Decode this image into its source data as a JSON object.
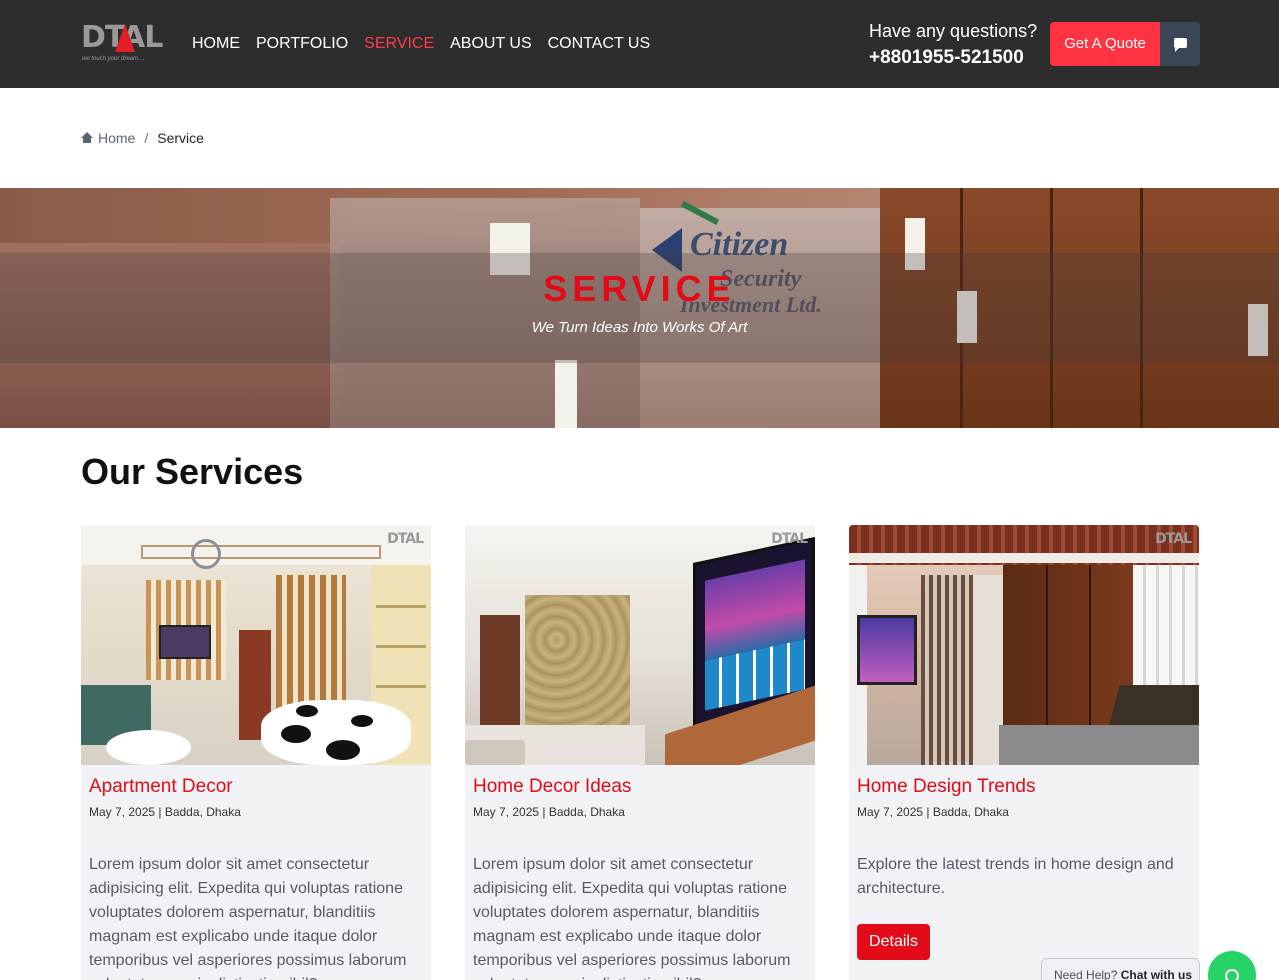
{
  "header": {
    "logo_text": "DTAL",
    "logo_tagline": "we touch your dream....",
    "nav": [
      {
        "label": "HOME"
      },
      {
        "label": "PORTFOLIO"
      },
      {
        "label": "SERVICE"
      },
      {
        "label": "ABOUT US"
      },
      {
        "label": "CONTACT US"
      }
    ],
    "active_nav": "SERVICE",
    "questions_label": "Have any questions?",
    "phone": "+8801955-521500",
    "quote_button": "Get A Quote",
    "chat_icon": "chat-icon"
  },
  "breadcrumb": {
    "home_icon": "home-icon",
    "home": "Home",
    "separator": "/",
    "current": "Service"
  },
  "hero": {
    "title": "SERVICE",
    "subtitle": "We Turn Ideas Into Works Of Art",
    "sign_line1": "Citizen",
    "sign_line2": "Security",
    "sign_line3": "Investment Ltd."
  },
  "services": {
    "heading": "Our Services",
    "cards": [
      {
        "title": "Apartment Decor",
        "meta": "May 7, 2025 | Badda, Dhaka",
        "text": "Lorem ipsum dolor sit amet consectetur adipisicing elit. Expedita qui voluptas ratione voluptates dolorem aspernatur, blanditiis magnam est explicabo unde itaque dolor temporibus vel asperiores possimus laborum voluptates omnis distinctio nihil?"
      },
      {
        "title": "Home Decor Ideas",
        "meta": "May 7, 2025 | Badda, Dhaka",
        "text": "Lorem ipsum dolor sit amet consectetur adipisicing elit. Expedita qui voluptas ratione voluptates dolorem aspernatur, blanditiis magnam est explicabo unde itaque dolor temporibus vel asperiores possimus laborum voluptates omnis distinctio nihil?"
      },
      {
        "title": "Home Design Trends",
        "meta": "May 7, 2025 | Badda, Dhaka",
        "text": "Explore the latest trends in home design and architecture.",
        "button": "Details"
      }
    ],
    "watermark": "DTAL"
  },
  "chat_widget": {
    "help_prefix": "Need Help?",
    "help_link": "Chat with us",
    "whatsapp_icon": "whatsapp-icon"
  },
  "colors": {
    "header_bg": "#2d2d2d",
    "accent_red": "#e30b17",
    "quote_red": "#ff3341",
    "card_bg": "#f0f2f6",
    "whatsapp_green": "#25d366"
  }
}
